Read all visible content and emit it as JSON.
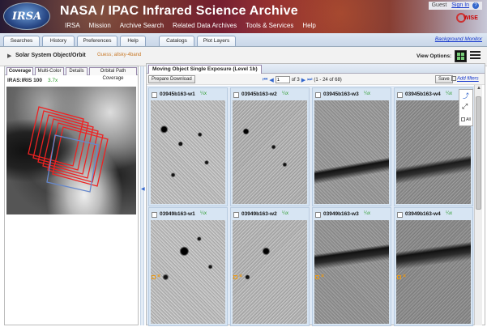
{
  "header": {
    "logo_text": "IRSA",
    "title": "NASA / IPAC Infrared Science Archive",
    "nav": [
      "IRSA",
      "Mission",
      "Archive Search",
      "Related Data Archives",
      "Tools & Services",
      "Help"
    ],
    "guest_label": "Guest",
    "sign_in": "Sign In",
    "wise_label": "WISE"
  },
  "tabs": [
    "Searches",
    "History",
    "Preferences",
    "Help",
    "Catalogs",
    "Plot Layers"
  ],
  "background_monitor": "Background Monitor",
  "subheader": {
    "title": "Solar System Object/Orbit",
    "subtitle": "Guess; allsky-4band",
    "view_options": "View Options:"
  },
  "left_panel": {
    "tabs": [
      "Coverage",
      "Multi-Color",
      "Details",
      "Orbital Path Coverage"
    ],
    "image_title": "IRAS:IRIS 100",
    "zoom": "3.7x"
  },
  "right_panel": {
    "tab_title": "Moving Object Single Exposure (Level 1b)",
    "prepare_download": "Prepare Download",
    "page_value": "1",
    "page_of": "of 3",
    "range": "(1 - 24 of 68)",
    "save": "Save",
    "add_filters": "Add filters",
    "zoom_label": "¼x",
    "thumbnails_row1": [
      "03945b163-w1",
      "03945b163-w2",
      "03945b163-w3",
      "03945b163-w4"
    ],
    "thumbnails_row2": [
      "03949b163-w1",
      "03949b163-w2",
      "03949b163-w3",
      "03949b163-w4"
    ],
    "all_label": "All"
  },
  "colors": {
    "accent": "#3366cc",
    "footprint_red": "#ee2222",
    "footprint_blue": "#6688cc",
    "marker_orange": "#e89a1a",
    "zoom_green": "#2a9a2a"
  }
}
